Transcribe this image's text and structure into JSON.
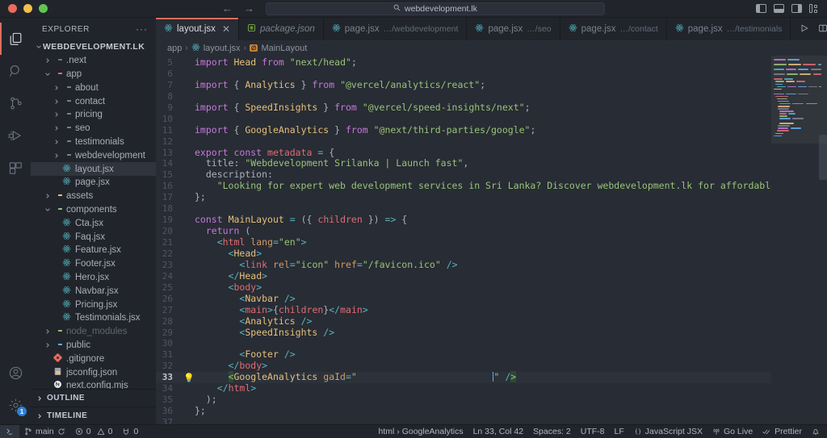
{
  "titlebar": {
    "traffic": [
      "close",
      "minimize",
      "zoom"
    ],
    "nav_back": "←",
    "nav_forward": "→",
    "search_icon": "search-icon",
    "search_text": "webdevelopment.lk",
    "layout_icons": [
      "toggle-primary-sidebar-icon",
      "toggle-panel-icon",
      "toggle-secondary-sidebar-icon",
      "customize-layout-icon"
    ]
  },
  "activitybar": {
    "items": [
      {
        "name": "explorer",
        "label": "Explorer",
        "active": true
      },
      {
        "name": "search",
        "label": "Search",
        "active": false
      },
      {
        "name": "source-control",
        "label": "Source Control",
        "active": false
      },
      {
        "name": "run-and-debug",
        "label": "Run and Debug",
        "active": false
      },
      {
        "name": "extensions",
        "label": "Extensions",
        "active": false
      }
    ],
    "bottom": [
      {
        "name": "accounts",
        "label": "Accounts",
        "badge": ""
      },
      {
        "name": "manage-settings",
        "label": "Manage",
        "badge": "1"
      }
    ]
  },
  "sidebar": {
    "title": "EXPLORER",
    "more_actions": "···",
    "root": {
      "label": "WEBDEVELOPMENT.LK",
      "expanded": true
    },
    "tree": [
      {
        "label": ".next",
        "indent": 1,
        "type": "folder",
        "state": "collapsed",
        "color": "#6b7280",
        "dim": false
      },
      {
        "label": "app",
        "indent": 1,
        "type": "folder",
        "state": "expanded",
        "color": "#e06c75",
        "dim": false
      },
      {
        "label": "about",
        "indent": 2,
        "type": "folder",
        "state": "collapsed",
        "color": "#7a8190",
        "dim": false
      },
      {
        "label": "contact",
        "indent": 2,
        "type": "folder",
        "state": "collapsed",
        "color": "#7a8190",
        "dim": false
      },
      {
        "label": "pricing",
        "indent": 2,
        "type": "folder",
        "state": "collapsed",
        "color": "#7a8190",
        "dim": false
      },
      {
        "label": "seo",
        "indent": 2,
        "type": "folder",
        "state": "collapsed",
        "color": "#7a8190",
        "dim": false
      },
      {
        "label": "testimonials",
        "indent": 2,
        "type": "folder",
        "state": "collapsed",
        "color": "#7a8190",
        "dim": false
      },
      {
        "label": "webdevelopment",
        "indent": 2,
        "type": "folder",
        "state": "collapsed",
        "color": "#7a8190",
        "dim": false
      },
      {
        "label": "layout.jsx",
        "indent": 2,
        "type": "react",
        "state": "none",
        "color": "#56b6c2",
        "dim": false,
        "selected": true
      },
      {
        "label": "page.jsx",
        "indent": 2,
        "type": "react",
        "state": "none",
        "color": "#56b6c2",
        "dim": false
      },
      {
        "label": "assets",
        "indent": 1,
        "type": "folder",
        "state": "collapsed",
        "color": "#e5c07b",
        "dim": false
      },
      {
        "label": "components",
        "indent": 1,
        "type": "folder",
        "state": "expanded",
        "color": "#98c379",
        "dim": false
      },
      {
        "label": "Cta.jsx",
        "indent": 2,
        "type": "react",
        "state": "none",
        "color": "#56b6c2",
        "dim": false
      },
      {
        "label": "Faq.jsx",
        "indent": 2,
        "type": "react",
        "state": "none",
        "color": "#56b6c2",
        "dim": false
      },
      {
        "label": "Feature.jsx",
        "indent": 2,
        "type": "react",
        "state": "none",
        "color": "#56b6c2",
        "dim": false
      },
      {
        "label": "Footer.jsx",
        "indent": 2,
        "type": "react",
        "state": "none",
        "color": "#56b6c2",
        "dim": false
      },
      {
        "label": "Hero.jsx",
        "indent": 2,
        "type": "react",
        "state": "none",
        "color": "#56b6c2",
        "dim": false
      },
      {
        "label": "Navbar.jsx",
        "indent": 2,
        "type": "react",
        "state": "none",
        "color": "#56b6c2",
        "dim": false
      },
      {
        "label": "Pricing.jsx",
        "indent": 2,
        "type": "react",
        "state": "none",
        "color": "#56b6c2",
        "dim": false
      },
      {
        "label": "Testimonials.jsx",
        "indent": 2,
        "type": "react",
        "state": "none",
        "color": "#56b6c2",
        "dim": false
      },
      {
        "label": "node_modules",
        "indent": 1,
        "type": "folder",
        "state": "collapsed",
        "color": "#98c379",
        "dim": true
      },
      {
        "label": "public",
        "indent": 1,
        "type": "folder",
        "state": "collapsed",
        "color": "#61afef",
        "dim": false
      },
      {
        "label": ".gitignore",
        "indent": 1,
        "type": "git",
        "state": "none",
        "color": "#e06c5e",
        "dim": false
      },
      {
        "label": "jsconfig.json",
        "indent": 1,
        "type": "json",
        "state": "none",
        "color": "#e5c07b",
        "dim": false
      },
      {
        "label": "next.config.mjs",
        "indent": 1,
        "type": "next",
        "state": "none",
        "color": "#dfe3ea",
        "dim": false
      }
    ],
    "sections": [
      {
        "label": "OUTLINE",
        "expanded": false
      },
      {
        "label": "TIMELINE",
        "expanded": false
      }
    ]
  },
  "tabs": [
    {
      "label": "layout.jsx",
      "sub": "",
      "icon": "react-icon",
      "active": true,
      "italic": false,
      "closable": true
    },
    {
      "label": "package.json",
      "sub": "",
      "icon": "npm-icon",
      "active": false,
      "italic": true,
      "closable": false
    },
    {
      "label": "page.jsx",
      "sub": "…/webdevelopment",
      "icon": "react-icon",
      "active": false,
      "italic": false,
      "closable": false
    },
    {
      "label": "page.jsx",
      "sub": "…/seo",
      "icon": "react-icon",
      "active": false,
      "italic": false,
      "closable": false
    },
    {
      "label": "page.jsx",
      "sub": "…/contact",
      "icon": "react-icon",
      "active": false,
      "italic": false,
      "closable": false
    },
    {
      "label": "page.jsx",
      "sub": "…/testimonials",
      "icon": "react-icon",
      "active": false,
      "italic": false,
      "closable": false
    }
  ],
  "tab_actions": [
    "run-icon",
    "split-editor-icon",
    "more-actions-icon"
  ],
  "breadcrumb": {
    "parts": [
      "app",
      "layout.jsx",
      "MainLayout"
    ],
    "symbol_badge": "∅"
  },
  "editor": {
    "first_line": 5,
    "highlight_line": 33,
    "lightbulb_line": 33,
    "lines": [
      {
        "n": 5,
        "text": "import Head from \"next/head\";"
      },
      {
        "n": 6,
        "text": ""
      },
      {
        "n": 7,
        "text": "import { Analytics } from \"@vercel/analytics/react\";"
      },
      {
        "n": 8,
        "text": ""
      },
      {
        "n": 9,
        "text": "import { SpeedInsights } from \"@vercel/speed-insights/next\";"
      },
      {
        "n": 10,
        "text": ""
      },
      {
        "n": 11,
        "text": "import { GoogleAnalytics } from \"@next/third-parties/google\";"
      },
      {
        "n": 12,
        "text": ""
      },
      {
        "n": 13,
        "text": "export const metadata = {"
      },
      {
        "n": 14,
        "text": "  title: \"Webdevelopment Srilanka | Launch fast\","
      },
      {
        "n": 15,
        "text": "  description:"
      },
      {
        "n": 16,
        "text": "    \"Looking for expert web development services in Sri Lanka? Discover webdevelopment.lk for affordable solutions today! Connec"
      },
      {
        "n": 17,
        "text": "};"
      },
      {
        "n": 18,
        "text": ""
      },
      {
        "n": 19,
        "text": "const MainLayout = ({ children }) => {"
      },
      {
        "n": 20,
        "text": "  return ("
      },
      {
        "n": 21,
        "text": "    <html lang=\"en\">"
      },
      {
        "n": 22,
        "text": "      <Head>"
      },
      {
        "n": 23,
        "text": "        <link rel=\"icon\" href=\"/favicon.ico\" />"
      },
      {
        "n": 24,
        "text": "      </Head>"
      },
      {
        "n": 25,
        "text": "      <body>"
      },
      {
        "n": 26,
        "text": "        <Navbar />"
      },
      {
        "n": 27,
        "text": "        <main>{children}</main>"
      },
      {
        "n": 28,
        "text": "        <Analytics />"
      },
      {
        "n": 29,
        "text": "        <SpeedInsights />"
      },
      {
        "n": 30,
        "text": ""
      },
      {
        "n": 31,
        "text": "        <Footer />"
      },
      {
        "n": 32,
        "text": "      </body>"
      },
      {
        "n": 33,
        "text": "      <GoogleAnalytics gaId=\"\" />"
      },
      {
        "n": 34,
        "text": "    </html>"
      },
      {
        "n": 35,
        "text": "  );"
      },
      {
        "n": 36,
        "text": "};"
      },
      {
        "n": 37,
        "text": ""
      }
    ]
  },
  "statusbar": {
    "remote_icon": "remote-window-icon",
    "branch_icon": "source-control-icon",
    "branch": "main",
    "sync_icon": "sync-icon",
    "errors_icon": "error-icon",
    "errors": "0",
    "warnings_icon": "warning-icon",
    "warnings": "0",
    "ports_icon": "ports-icon",
    "ports": "0",
    "language_path": "html › GoogleAnalytics",
    "cursor_position": "Ln 33, Col 42",
    "indentation": "Spaces: 2",
    "encoding": "UTF-8",
    "eol": "LF",
    "language_mode": "JavaScript JSX",
    "language_icon": "braces-icon",
    "go_live": "Go Live",
    "go_live_icon": "broadcast-icon",
    "prettier": "Prettier",
    "prettier_icon": "check-check-icon",
    "bell_icon": "bell-icon"
  },
  "colors": {
    "accent_orange": "#e06c5e",
    "editor_bg": "#282c34",
    "chrome_bg": "#21252b",
    "selection": "#2c313a",
    "badge_blue": "#2f7fd8"
  }
}
